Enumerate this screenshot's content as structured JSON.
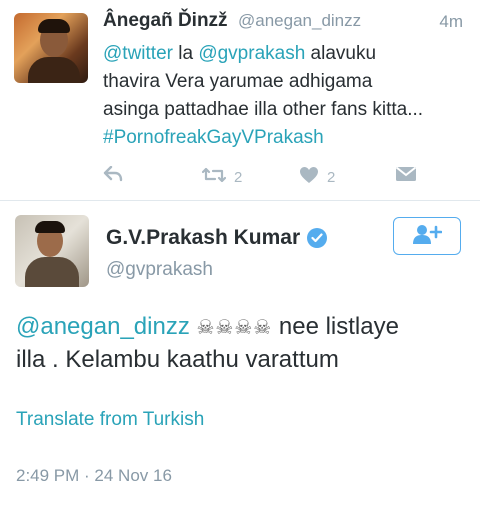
{
  "tweet1": {
    "display_name": "Ânegañ Ďinzž",
    "handle": "@anegan_dinzz",
    "time": "4m",
    "text_line1_mention1": "@twitter",
    "text_line1_mid": " la ",
    "text_line1_mention2": "@gvprakash",
    "text_line1_end": "  alavuku",
    "text_line2": "thavira Vera yarumae adhigama",
    "text_line3": "asinga pattadhae illa  other fans kitta...",
    "hashtag": "#PornofreakGayVPrakash",
    "retweet_count": "2",
    "like_count": "2"
  },
  "tweet2": {
    "display_name": "G.V.Prakash Kumar",
    "handle": "@gvprakash",
    "mention": "@anegan_dinzz",
    "skulls": "☠☠☠☠",
    "text_after_skulls": " nee listlaye",
    "text_line2": "illa . Kelambu kaathu varattum",
    "translate_label": "Translate from Turkish",
    "timestamp": "2:49 PM · 24 Nov 16"
  },
  "colors": {
    "link": "#2aa3b8",
    "muted": "#8899a6",
    "verified": "#55acee",
    "text": "#292f33"
  },
  "icons": [
    "reply-icon",
    "retweet-icon",
    "like-icon",
    "direct-message-icon",
    "verified-icon",
    "follow-user-icon"
  ]
}
